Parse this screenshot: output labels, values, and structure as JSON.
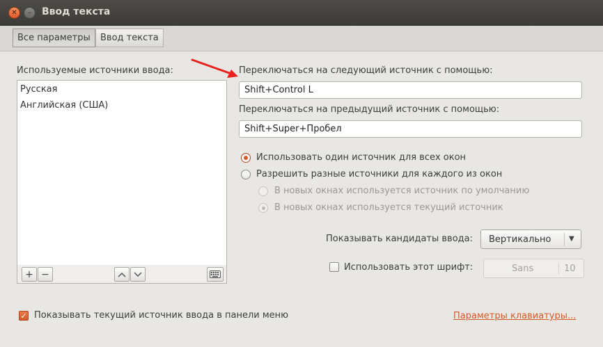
{
  "window": {
    "title": "Ввод текста"
  },
  "tabs": [
    {
      "label": "Все параметры",
      "active": true
    },
    {
      "label": "Ввод текста",
      "active": false
    }
  ],
  "sources": {
    "label": "Используемые источники ввода:",
    "items": [
      "Русская",
      "Английская (США)"
    ],
    "toolbar": {
      "add": "+",
      "remove": "−"
    }
  },
  "next_shortcut": {
    "label": "Переключаться на следующий источник с помощью:",
    "value": "Shift+Control L"
  },
  "prev_shortcut": {
    "label": "Переключаться на предыдущий источник с помощью:",
    "value": "Shift+Super+Пробел"
  },
  "radios": {
    "same_source": "Использовать один источник для всех окон",
    "per_window": "Разрешить разные источники для каждого из окон",
    "default_source": "В новых окнах используется источник по умолчанию",
    "current_source": "В новых окнах используется текущий источник"
  },
  "candidates": {
    "label": "Показывать кандидаты ввода:",
    "value": "Вертикально"
  },
  "font": {
    "label": "Использовать этот шрифт:",
    "name": "Sans",
    "size": "10"
  },
  "footer": {
    "show_in_menu": "Показывать текущий источник ввода в панели меню",
    "keyboard_settings": "Параметры клавиатуры..."
  },
  "colors": {
    "accent": "#d35b2a",
    "annotation_arrow": "#e8211c"
  }
}
